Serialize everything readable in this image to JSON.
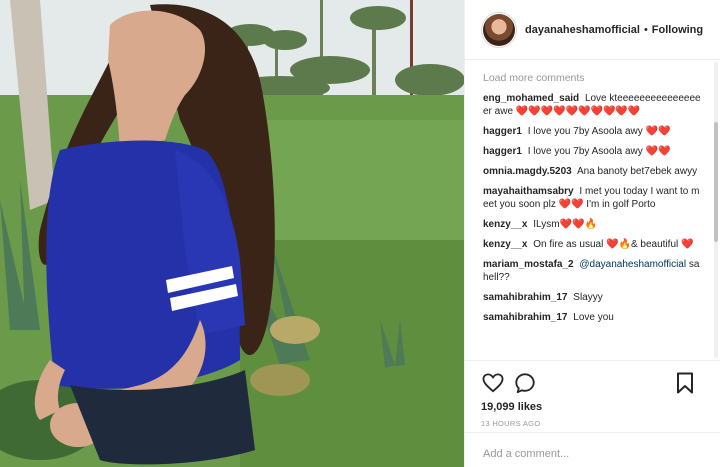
{
  "post": {
    "image_description_icon": "photo-icon"
  },
  "header": {
    "username": "dayanaheshamofficial",
    "separator": "•",
    "follow_status": "Following"
  },
  "comments": {
    "load_more": "Load more comments",
    "items": [
      {
        "user": "eng_mohamed_said",
        "text": "Love kteeeeeeeeeeeeeeeer awe ❤️❤️❤️❤️❤️❤️❤️❤️❤️❤️"
      },
      {
        "user": "hagger1",
        "text": "I love you 7by Asoola awy ❤️❤️"
      },
      {
        "user": "hagger1",
        "text": "I love you 7by Asoola awy ❤️❤️"
      },
      {
        "user": "omnia.magdy.5203",
        "text": "Ana banoty bet7ebek awyy"
      },
      {
        "user": "mayahaithamsabry",
        "text": "I met you today I want to meet you soon plz ❤️❤️ I'm in golf Porto"
      },
      {
        "user": "kenzy__x",
        "text": "ILysm❤️❤️🔥"
      },
      {
        "user": "kenzy__x",
        "text": "On fire as usual ❤️🔥& beautiful ❤️"
      },
      {
        "user": "mariam_mostafa_2",
        "mention": "@dayanaheshamofficial",
        "text": "sahell??"
      },
      {
        "user": "samahibrahim_17",
        "text": "Slayyy"
      },
      {
        "user": "samahibrahim_17",
        "text": "Love you"
      }
    ]
  },
  "actions": {
    "like_icon": "heart-icon",
    "comment_icon": "comment-icon",
    "save_icon": "bookmark-icon",
    "likes": "19,099 likes",
    "time_ago": "13 HOURS AGO"
  },
  "add_comment": {
    "placeholder": "Add a comment..."
  }
}
